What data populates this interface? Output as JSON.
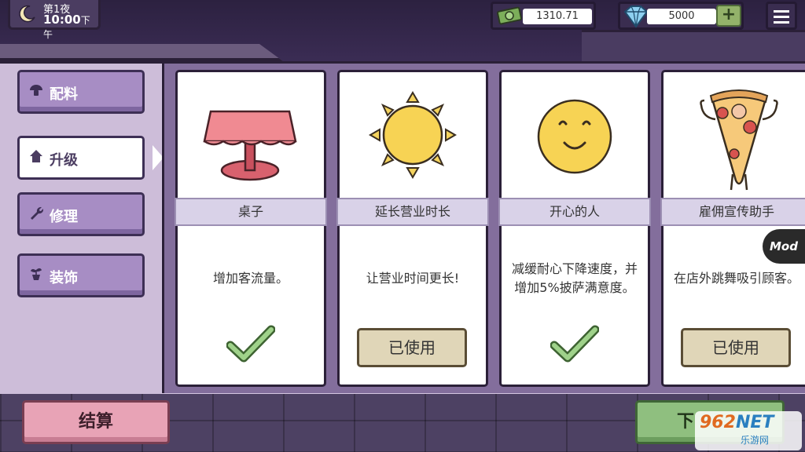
{
  "hud": {
    "night_label": "第1夜",
    "time": "10:00",
    "time_suffix": "下午",
    "money": "1310.71",
    "gems": "5000",
    "add_gems_label": "+",
    "icons": {
      "moon": "moon-icon",
      "money": "money-icon",
      "gem": "diamond-icon",
      "menu": "hamburger-menu-icon"
    }
  },
  "tabs": [
    {
      "label": "配料",
      "icon": "mushroom-icon",
      "active": false
    },
    {
      "label": "升级",
      "icon": "home-icon",
      "active": true
    },
    {
      "label": "修理",
      "icon": "wrench-icon",
      "active": false
    },
    {
      "label": "装饰",
      "icon": "plant-pot-icon",
      "active": false
    }
  ],
  "cards": [
    {
      "title": "桌子",
      "desc": "增加客流量。",
      "status": "check",
      "image": "table-icon"
    },
    {
      "title": "延长营业时长",
      "desc": "让营业时间更长!",
      "status": "used",
      "status_label": "已使用",
      "image": "sun-icon"
    },
    {
      "title": "开心的人",
      "desc": "减缓耐心下降速度，并增加5%披萨满意度。",
      "status": "check",
      "image": "smiley-face-icon"
    },
    {
      "title": "雇佣宣传助手",
      "desc": "在店外跳舞吸引顾客。",
      "status": "used",
      "status_label": "已使用",
      "image": "pizza-mascot-icon"
    }
  ],
  "bottom": {
    "settle_label": "结算",
    "next_label": "下"
  },
  "overlays": {
    "mod_badge": "Mod",
    "watermark_logo": "962",
    "watermark_logo_suffix": "NET",
    "watermark_sub": "乐游网"
  },
  "colors": {
    "panel": "#d5c6e1",
    "tab": "#a78dc4",
    "settle": "#e8a3b6",
    "next": "#8fbf7f",
    "check": "#7fb56b"
  }
}
